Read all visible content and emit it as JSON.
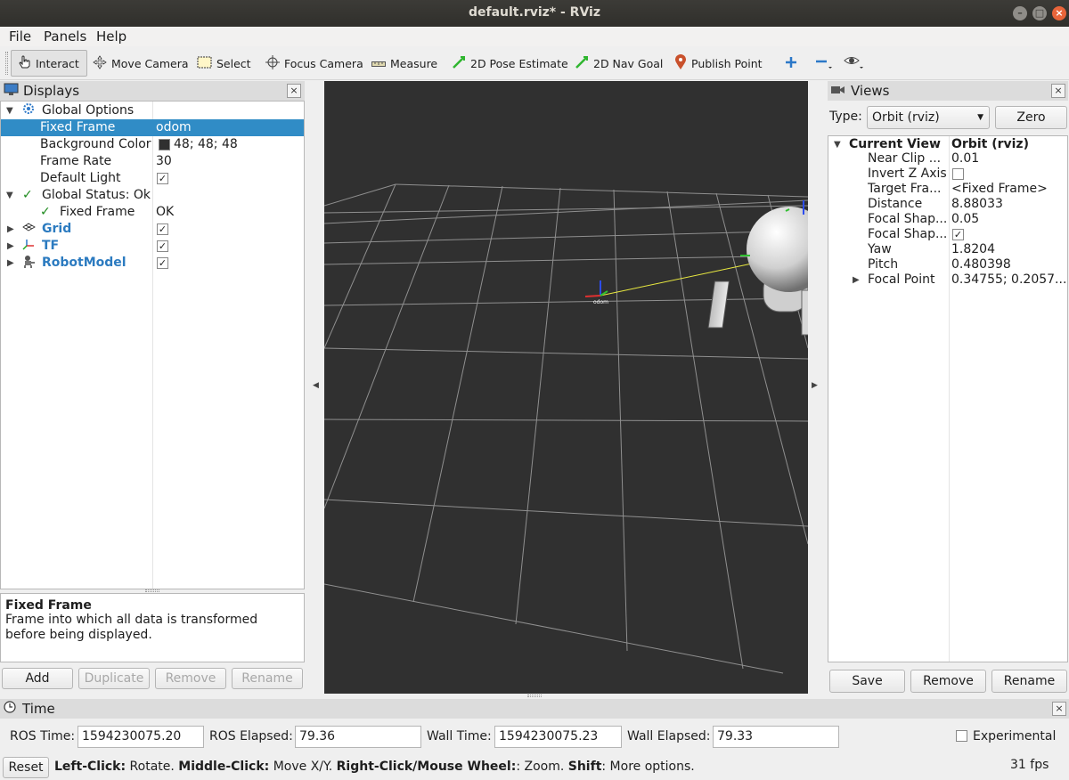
{
  "window": {
    "title": "default.rviz* - RViz"
  },
  "menu": {
    "file": "File",
    "panels": "Panels",
    "help": "Help"
  },
  "toolbar": {
    "interact": "Interact",
    "move_camera": "Move Camera",
    "select": "Select",
    "focus_camera": "Focus Camera",
    "measure": "Measure",
    "pose_estimate": "2D Pose Estimate",
    "nav_goal": "2D Nav Goal",
    "publish_point": "Publish Point"
  },
  "displays": {
    "title": "Displays",
    "rows": {
      "global_options": "Global Options",
      "fixed_frame": "Fixed Frame",
      "fixed_frame_value": "odom",
      "background_color": "Background Color",
      "background_color_value": "48; 48; 48",
      "frame_rate": "Frame Rate",
      "frame_rate_value": "30",
      "default_light": "Default Light",
      "global_status": "Global Status: Ok",
      "status_fixed_frame": "Fixed Frame",
      "status_fixed_frame_value": "OK",
      "grid": "Grid",
      "tf": "TF",
      "robot_model": "RobotModel"
    },
    "help_title": "Fixed Frame",
    "help_text": "Frame into which all data is transformed before being displayed.",
    "buttons": {
      "add": "Add",
      "duplicate": "Duplicate",
      "remove": "Remove",
      "rename": "Rename"
    }
  },
  "views": {
    "title": "Views",
    "type_label": "Type:",
    "type_value": "Orbit (rviz)",
    "zero": "Zero",
    "current_view": "Current View",
    "current_view_value": "Orbit (rviz)",
    "props": [
      {
        "name": "Near Clip ...",
        "value": "0.01"
      },
      {
        "name": "Invert Z Axis",
        "value": ""
      },
      {
        "name": "Target Fra...",
        "value": "<Fixed Frame>"
      },
      {
        "name": "Distance",
        "value": "8.88033"
      },
      {
        "name": "Focal Shap...",
        "value": "0.05"
      },
      {
        "name": "Focal Shap...",
        "value": ""
      },
      {
        "name": "Yaw",
        "value": "1.8204"
      },
      {
        "name": "Pitch",
        "value": "0.480398"
      },
      {
        "name": "Focal Point",
        "value": "0.34755; 0.2057..."
      }
    ],
    "buttons": {
      "save": "Save",
      "remove": "Remove",
      "rename": "Rename"
    }
  },
  "render": {
    "frame_label": "odom",
    "background": "#303030"
  },
  "time": {
    "title": "Time",
    "ros_time_label": "ROS Time:",
    "ros_time": "1594230075.20",
    "ros_elapsed_label": "ROS Elapsed:",
    "ros_elapsed": "79.36",
    "wall_time_label": "Wall Time:",
    "wall_time": "1594230075.23",
    "wall_elapsed_label": "Wall Elapsed:",
    "wall_elapsed": "79.33",
    "experimental": "Experimental"
  },
  "status": {
    "reset": "Reset",
    "left_click": "Left-Click:",
    "left_click_desc": " Rotate. ",
    "middle_click": "Middle-Click:",
    "middle_click_desc": " Move X/Y. ",
    "right_click": "Right-Click/Mouse Wheel:",
    "right_click_desc": ": Zoom. ",
    "shift": "Shift",
    "shift_desc": ": More options.",
    "fps": "31 fps"
  }
}
